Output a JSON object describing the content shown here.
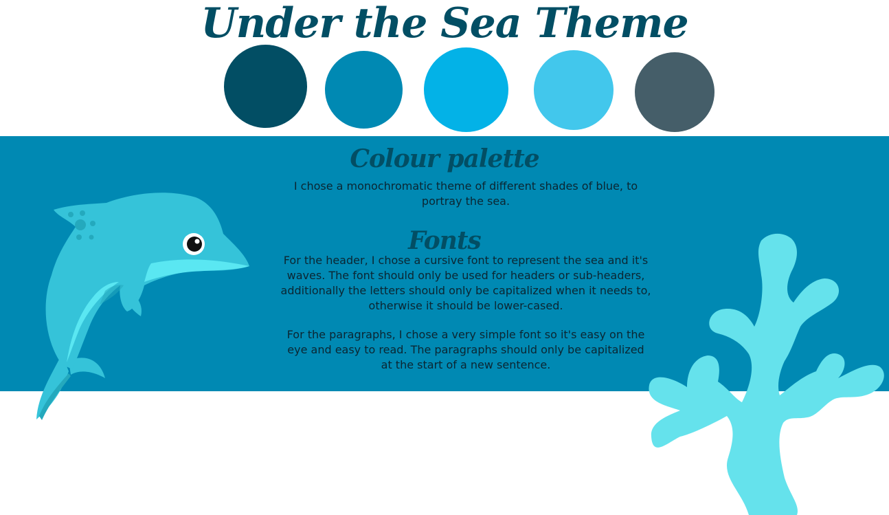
{
  "page": {
    "title": "Under the Sea Theme"
  },
  "palette": {
    "swatches": [
      {
        "name": "swatch-1",
        "color": "#024e64"
      },
      {
        "name": "swatch-2",
        "color": "#0089b3"
      },
      {
        "name": "swatch-3",
        "color": "#03b2e7"
      },
      {
        "name": "swatch-4",
        "color": "#42c7ec"
      },
      {
        "name": "swatch-5",
        "color": "#455e69"
      }
    ]
  },
  "colors": {
    "title": "#024e64",
    "band": "#0089b3",
    "heading": "#024e64",
    "text": "#0b2632",
    "dolphin_body": "#35c3d9",
    "dolphin_light": "#5ae7f2",
    "dolphin_spots": "#24a9bd",
    "coral": "#65e2ec"
  },
  "sections": {
    "colour_palette": {
      "heading": "Colour palette",
      "lines": [
        "I chose a monochromatic theme of different shades of blue, to",
        "portray the sea."
      ]
    },
    "fonts": {
      "heading": "Fonts",
      "para1_lines": [
        "For the header, I chose a cursive font to represent the sea and it's",
        "waves. The font should only be used for headers or sub-headers,",
        "additionally the letters should only be capitalized when it needs to,",
        "otherwise it should be lower-cased."
      ],
      "para2_lines": [
        "For the paragraphs, I chose a very simple font so it's easy on the",
        "eye and easy to read.  The paragraphs should only be capitalized",
        "at the start of a new sentence."
      ]
    }
  },
  "illustrations": {
    "dolphin": "dolphin-illustration",
    "coral": "coral-illustration"
  }
}
